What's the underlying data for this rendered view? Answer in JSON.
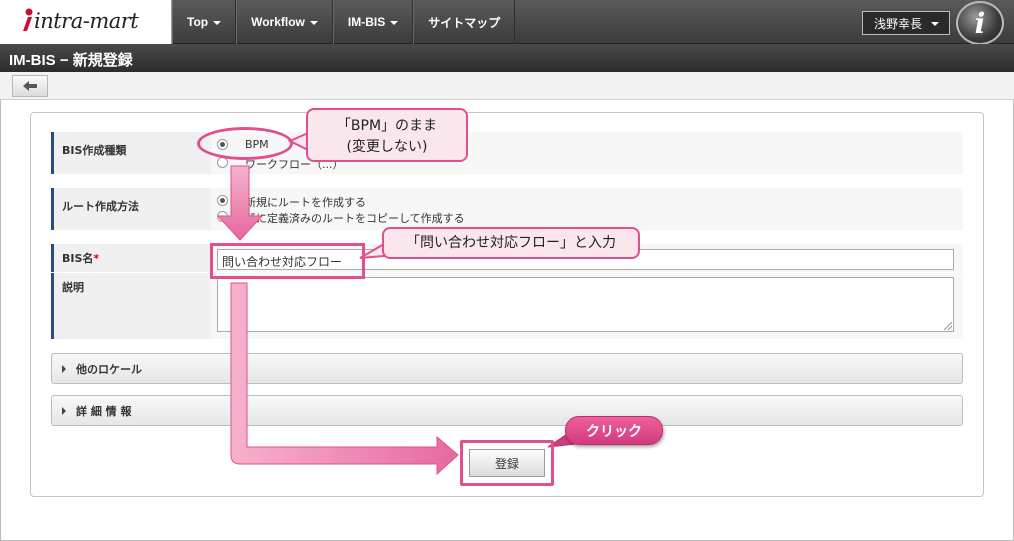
{
  "header": {
    "logo": "intra-mart",
    "nav": [
      "Top",
      "Workflow",
      "IM-BIS",
      "サイトマップ"
    ],
    "user_name": "浅野幸長"
  },
  "page_title": "IM-BIS − 新規登録",
  "form": {
    "bis_type_label": "BIS作成種類",
    "bis_type_options": [
      "BPM",
      "ワークフロー（...）"
    ],
    "route_method_label": "ルート作成方法",
    "route_method_options": [
      "新規にルートを作成する",
      "既に定義済みのルートをコピーして作成する"
    ],
    "bis_name_label": "BIS名",
    "required_mark": "*",
    "bis_name_value": "問い合わせ対応フロー",
    "description_label": "説明",
    "description_value": "",
    "other_locale": "他のロケール",
    "details": "詳 細 情 報",
    "submit": "登録"
  },
  "annotations": {
    "callout_bpm_line1": "「BPM」のまま",
    "callout_bpm_line2": "(変更しない)",
    "callout_name": "「問い合わせ対応フロー」と入力",
    "callout_click": "クリック"
  },
  "colors": {
    "highlight": "#e0508f",
    "callout_fill": "#fbe6ee",
    "label_accent": "#2b4a8a"
  }
}
